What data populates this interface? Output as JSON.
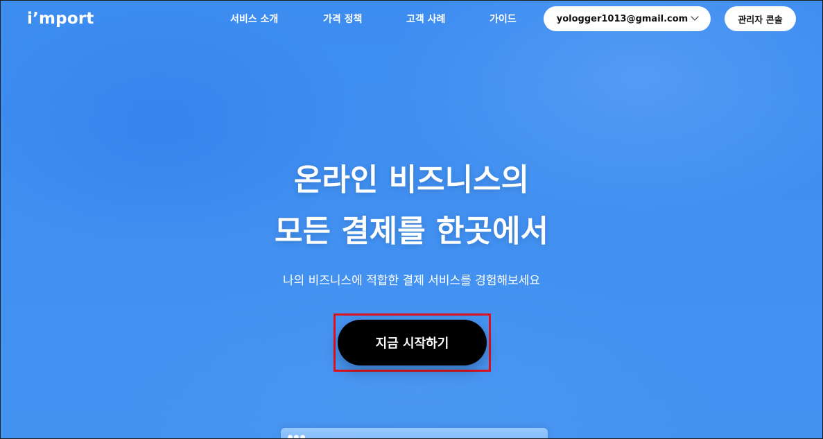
{
  "brand": {
    "logo_text": "i’mport"
  },
  "nav": {
    "items": [
      {
        "label": "서비스 소개"
      },
      {
        "label": "가격 정책"
      },
      {
        "label": "고객 사례"
      },
      {
        "label": "가이드"
      }
    ]
  },
  "account": {
    "email": "yologger1013@gmail.com",
    "console_label": "관리자 콘솔"
  },
  "hero": {
    "title_line1": "온라인 비즈니스의",
    "title_line2": "모든 결제를 한곳에서",
    "subtitle": "나의 비즈니스에 적합한 결제 서비스를 경험해보세요",
    "cta_label": "지금 시작하기"
  },
  "colors": {
    "background": "#3f8ef0",
    "cta_background": "#000000",
    "highlight_border": "#e0101a",
    "pill_background": "#ffffff"
  },
  "icons": {
    "account_dropdown": "chevron-down-icon"
  }
}
